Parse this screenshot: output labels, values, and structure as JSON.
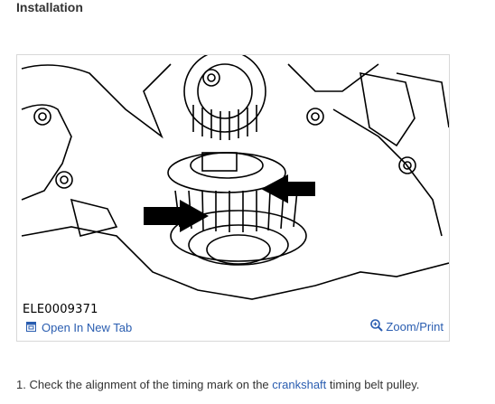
{
  "heading": "Installation",
  "figure": {
    "caption": "ELE0009371",
    "open_tab_label": "Open In New Tab",
    "zoom_label": "Zoom/Print"
  },
  "step": {
    "number": "1.",
    "text_before": "Check the alignment of the timing mark on the",
    "link_text": "crankshaft",
    "text_after": "timing belt pulley."
  },
  "colors": {
    "link": "#2a5db0",
    "text": "#333333",
    "border": "#d8d8d8"
  }
}
